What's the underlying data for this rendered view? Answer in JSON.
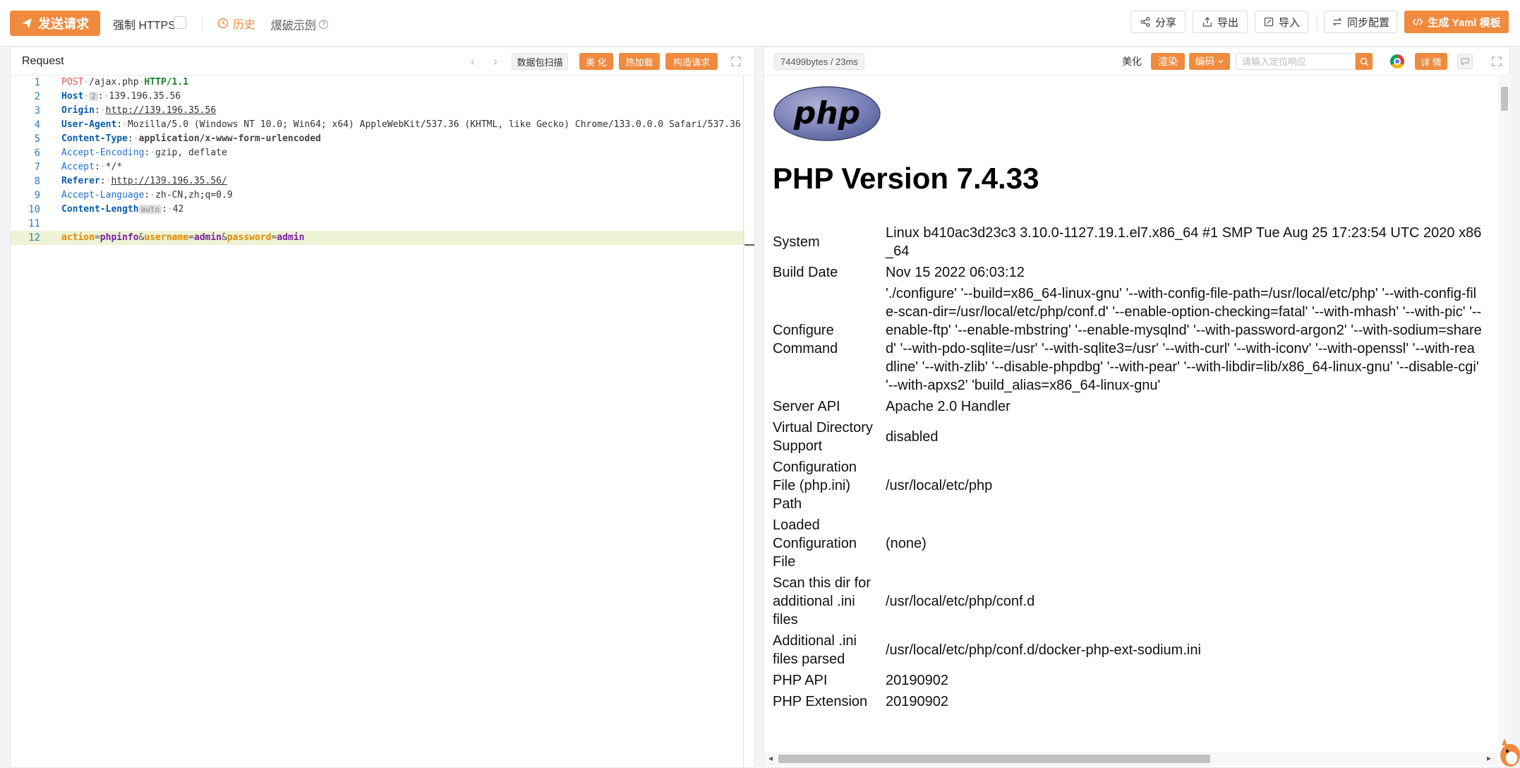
{
  "toolbar": {
    "send_label": "发送请求",
    "force_https_label": "强制 HTTPS",
    "history_label": "历史",
    "example_label": "爆破示例",
    "help_glyph": "?",
    "share_label": "分享",
    "export_label": "导出",
    "import_label": "导入",
    "sync_label": "同步配置",
    "yaml_label": "生成 Yaml 模板"
  },
  "request_panel": {
    "title": "Request",
    "scan_label": "数据包扫描",
    "beautify_label": "美 化",
    "hotload_label": "热加载",
    "build_label": "构造请求",
    "lines": [
      {
        "num": "1",
        "method": "POST",
        "path": "/ajax.php",
        "version": "HTTP/1.1"
      },
      {
        "num": "2",
        "key": "Host",
        "badge": "2",
        "value": "139.196.35.56"
      },
      {
        "num": "3",
        "key": "Origin",
        "value": "http://139.196.35.56"
      },
      {
        "num": "4",
        "key": "User-Agent",
        "value": "Mozilla/5.0 (Windows NT 10.0; Win64; x64) AppleWebKit/537.36 (KHTML, like Gecko) Chrome/133.0.0.0 Safari/537.36"
      },
      {
        "num": "5",
        "key": "Content-Type",
        "value": "application/x-www-form-urlencoded"
      },
      {
        "num": "6",
        "key": "Accept-Encoding",
        "value": "gzip, deflate"
      },
      {
        "num": "7",
        "key": "Accept",
        "value": "*/*"
      },
      {
        "num": "8",
        "key": "Referer",
        "value": "http://139.196.35.56/"
      },
      {
        "num": "9",
        "key": "Accept-Language",
        "value": "zh-CN,zh;q=0.9"
      },
      {
        "num": "10",
        "key": "Content-Length",
        "badge": "auto",
        "value": "42"
      },
      {
        "num": "11"
      },
      {
        "num": "12",
        "body": [
          {
            "k": "action",
            "v": "phpinfo"
          },
          {
            "k": "username",
            "v": "admin"
          },
          {
            "k": "password",
            "v": "admin"
          }
        ]
      }
    ]
  },
  "response_panel": {
    "size_label": "74499bytes / 23ms",
    "beautify_label": "美化",
    "render_label": "渲染",
    "encoding_label": "编码",
    "search_placeholder": "请输入定位响应",
    "detail_label": "详 情",
    "php_logo_text": "php",
    "php_title": "PHP Version 7.4.33",
    "info_rows": [
      {
        "k": "System",
        "v": "Linux b410ac3d23c3 3.10.0-1127.19.1.el7.x86_64 #1 SMP Tue Aug 25 17:23:54 UTC 2020 x86_64"
      },
      {
        "k": "Build Date",
        "v": "Nov 15 2022 06:03:12"
      },
      {
        "k": "Configure Command",
        "v": "'./configure' '--build=x86_64-linux-gnu' '--with-config-file-path=/usr/local/etc/php' '--with-config-file-scan-dir=/usr/local/etc/php/conf.d' '--enable-option-checking=fatal' '--with-mhash' '--with-pic' '--enable-ftp' '--enable-mbstring' '--enable-mysqlnd' '--with-password-argon2' '--with-sodium=shared' '--with-pdo-sqlite=/usr' '--with-sqlite3=/usr' '--with-curl' '--with-iconv' '--with-openssl' '--with-readline' '--with-zlib' '--disable-phpdbg' '--with-pear' '--with-libdir=lib/x86_64-linux-gnu' '--disable-cgi' '--with-apxs2' 'build_alias=x86_64-linux-gnu'"
      },
      {
        "k": "Server API",
        "v": "Apache 2.0 Handler"
      },
      {
        "k": "Virtual Directory Support",
        "v": "disabled"
      },
      {
        "k": "Configuration File (php.ini) Path",
        "v": "/usr/local/etc/php"
      },
      {
        "k": "Loaded Configuration File",
        "v": "(none)"
      },
      {
        "k": "Scan this dir for additional .ini files",
        "v": "/usr/local/etc/php/conf.d"
      },
      {
        "k": "Additional .ini files parsed",
        "v": "/usr/local/etc/php/conf.d/docker-php-ext-sodium.ini"
      },
      {
        "k": "PHP API",
        "v": "20190902"
      },
      {
        "k": "PHP Extension",
        "v": "20190902"
      }
    ]
  },
  "colors": {
    "accent": "#f08a3e",
    "method": "#e05a4a",
    "header_key": "#0b5cad",
    "version": "#1a7f2b",
    "body_key": "#e08a00",
    "body_value": "#7a1fa2",
    "highlight_line": "#eef3d6"
  }
}
